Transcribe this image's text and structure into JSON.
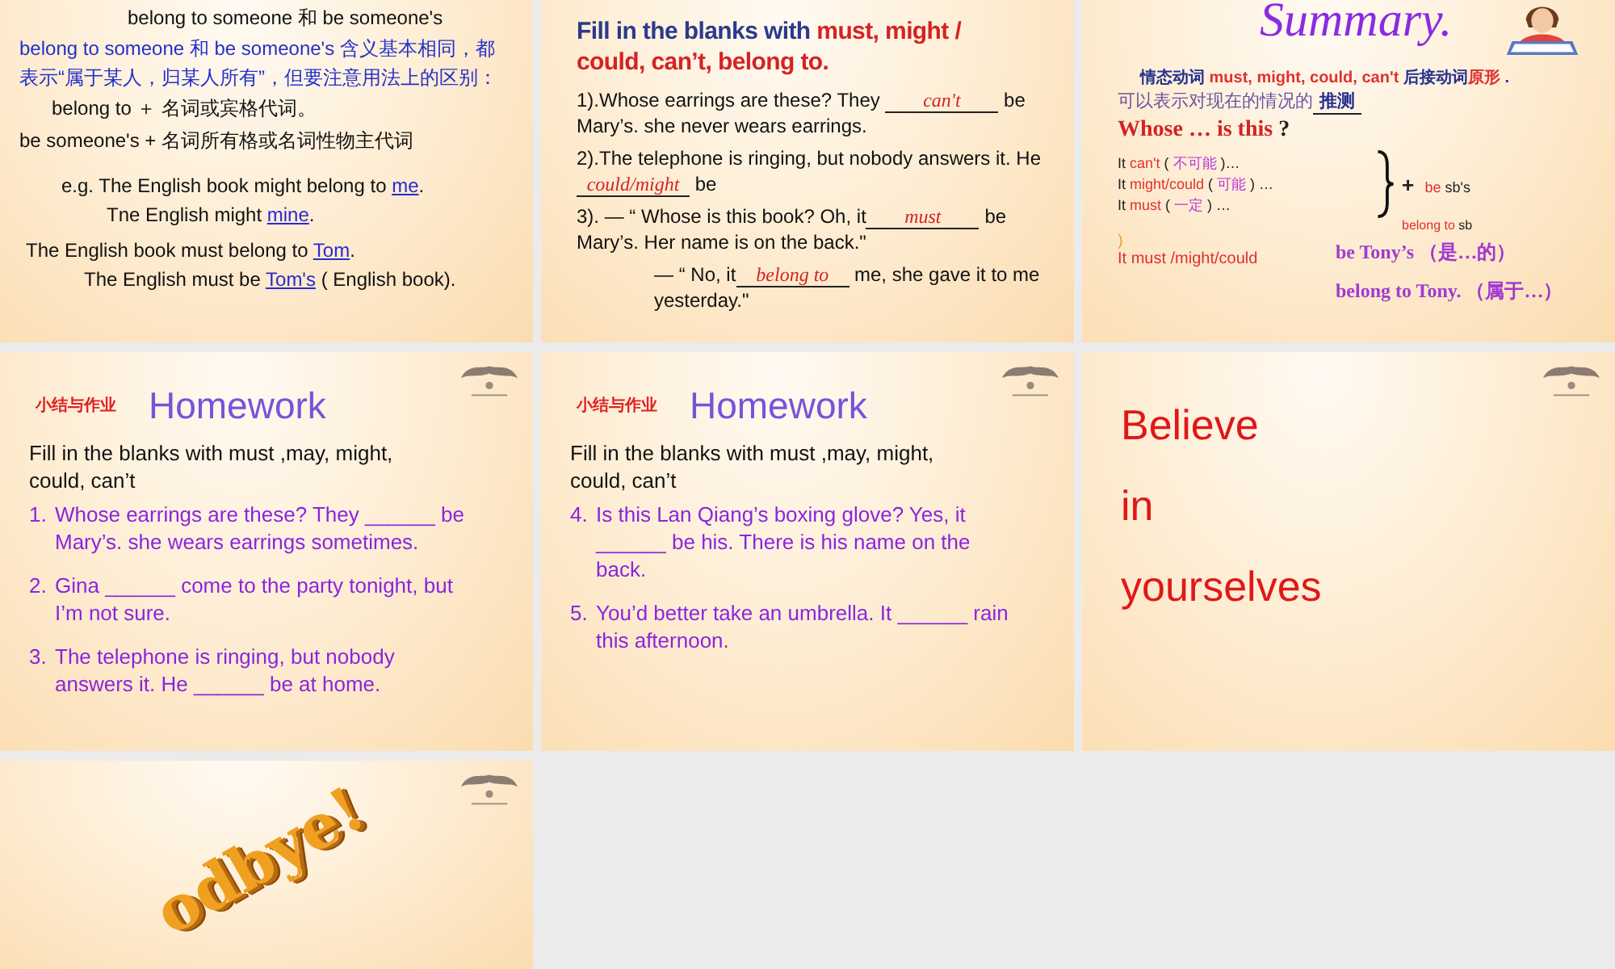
{
  "slides": [
    {
      "kind": "notes",
      "lines": [
        [
          {
            "text": "belong to someone  和  be someone's"
          }
        ],
        [
          {
            "text": "belong to someone  和  be someone's  含义基本相同，都表示“属于某人，归某人所有”，但要注意用法上的区别："
          }
        ],
        [
          {
            "text": "belong to   ＋   名词或宾格代词。"
          }
        ],
        [
          {
            "text": "be someone's  +  名词所有格或名词性物主代词"
          }
        ],
        [
          {
            "text": "e.g.   The English book might belong to "
          },
          {
            "kind": "link",
            "text": "me"
          },
          {
            "text": "."
          }
        ],
        [
          {
            "text": "Tne English might "
          },
          {
            "kind": "link",
            "text": "mine"
          },
          {
            "text": "."
          }
        ],
        [
          {
            "text": "The English book must belong to "
          },
          {
            "kind": "link",
            "text": "Tom"
          },
          {
            "text": "."
          }
        ],
        [
          {
            "text": "The English must be "
          },
          {
            "kind": "link",
            "text": "Tom's"
          },
          {
            "text": " ( English book)."
          }
        ]
      ]
    },
    {
      "kind": "exercise",
      "heading": [
        {
          "text": "Fill in the blanks with "
        },
        {
          "text": "must, might / could, can’t, belong to.",
          "color": "#d42323"
        }
      ],
      "items": [
        [
          {
            "text": "1).Whose earrings are these? They "
          },
          {
            "kind": "blank",
            "answer": "can't"
          },
          {
            "text": " be Mary’s. she never wears earrings."
          }
        ],
        [
          {
            "text": "2).The telephone is ringing, but nobody answers it. He "
          },
          {
            "kind": "blank",
            "answer": "could/might"
          },
          {
            "text": " be"
          }
        ],
        [
          {
            "text": "3). —  “ Whose is this book?  Oh,  it"
          },
          {
            "kind": "blank",
            "answer": "must"
          },
          {
            "text": " be Mary’s. Her name is on the back.\""
          }
        ],
        [
          {
            "text": "—  “ No, it"
          },
          {
            "kind": "blank",
            "answer": "belong to"
          },
          {
            "text": " me,  she gave it to me yesterday.\""
          }
        ]
      ]
    },
    {
      "kind": "summary",
      "title": "Summary.",
      "rule": [
        {
          "text": "情态动词 ",
          "color": "#27318f"
        },
        {
          "text": "must, might, could, can't ",
          "color": "#e03030"
        },
        {
          "text": "后接动词",
          "color": "#27318f"
        },
        {
          "text": "原形",
          "color": "#e03030"
        },
        {
          "text": " .",
          "color": "#27318f"
        }
      ],
      "guess": [
        {
          "text": "可以表示对现在的情况的"
        },
        {
          "kind": "blank",
          "answer": "推测"
        }
      ],
      "question": [
        {
          "text": "Whose … is this ",
          "color": "#d42323"
        },
        {
          "text": "?",
          "color": "#222222"
        }
      ],
      "options": [
        [
          {
            "text": "It ",
            "color": "#222222"
          },
          {
            "text": "can't ",
            "color": "#e03030"
          },
          {
            "text": "( ",
            "color": "#222222"
          },
          {
            "text": "不可能",
            "color": "#b73ad8"
          },
          {
            "text": " )…",
            "color": "#222222"
          }
        ],
        [
          {
            "text": "It ",
            "color": "#222222"
          },
          {
            "text": "might/could ",
            "color": "#e03030"
          },
          {
            "text": "(   ",
            "color": "#222222"
          },
          {
            "text": "可能",
            "color": "#b73ad8"
          },
          {
            "text": "  ) …",
            "color": "#222222"
          }
        ],
        [
          {
            "text": "It ",
            "color": "#222222"
          },
          {
            "text": "must ",
            "color": "#e03030"
          },
          {
            "text": " (  ",
            "color": "#222222"
          },
          {
            "text": "一定",
            "color": "#b73ad8"
          },
          {
            "text": "  ) …",
            "color": "#222222"
          }
        ]
      ],
      "suffix": [
        {
          "text": "+ ",
          "color": "#222222"
        },
        {
          "text": "be ",
          "color": "#e03030"
        },
        {
          "text": " sb's",
          "color": "#222222"
        }
      ],
      "belong": [
        {
          "text": "belong to ",
          "color": "#e03030"
        },
        {
          "text": "sb",
          "color": "#222222"
        }
      ],
      "mark": ")",
      "must": "It must /might/could",
      "tony": [
        "be Tony’s （是…的）",
        "belong to Tony. （属于…）"
      ]
    },
    {
      "kind": "homework",
      "tag": "小结与作业",
      "title": "Homework",
      "intro": "Fill in the blanks with must ,may, might, could, can’t",
      "items": [
        {
          "number": "1.",
          "text": "Whose earrings are these? They ______ be Mary’s. she wears earrings sometimes."
        },
        {
          "number": "2.",
          "text": "Gina ______ come to the party tonight, but I’m not sure."
        },
        {
          "number": "3.",
          "text": "The telephone is ringing, but nobody answers it. He ______ be  at home."
        }
      ]
    },
    {
      "kind": "homework",
      "tag": "小结与作业",
      "title": "Homework",
      "intro": "Fill in the blanks with must ,may, might, could, can’t",
      "items": [
        {
          "number": "4.",
          "text": "Is this Lan Qiang’s boxing glove? Yes, it ______ be his. There is his name on the back."
        },
        {
          "number": "5.",
          "text": "You’d better take an umbrella. It ______ rain this afternoon."
        }
      ]
    },
    {
      "kind": "motto",
      "lines": [
        "Believe",
        "in",
        "yourselves"
      ]
    },
    {
      "kind": "farewell",
      "text": "odbye!"
    }
  ]
}
